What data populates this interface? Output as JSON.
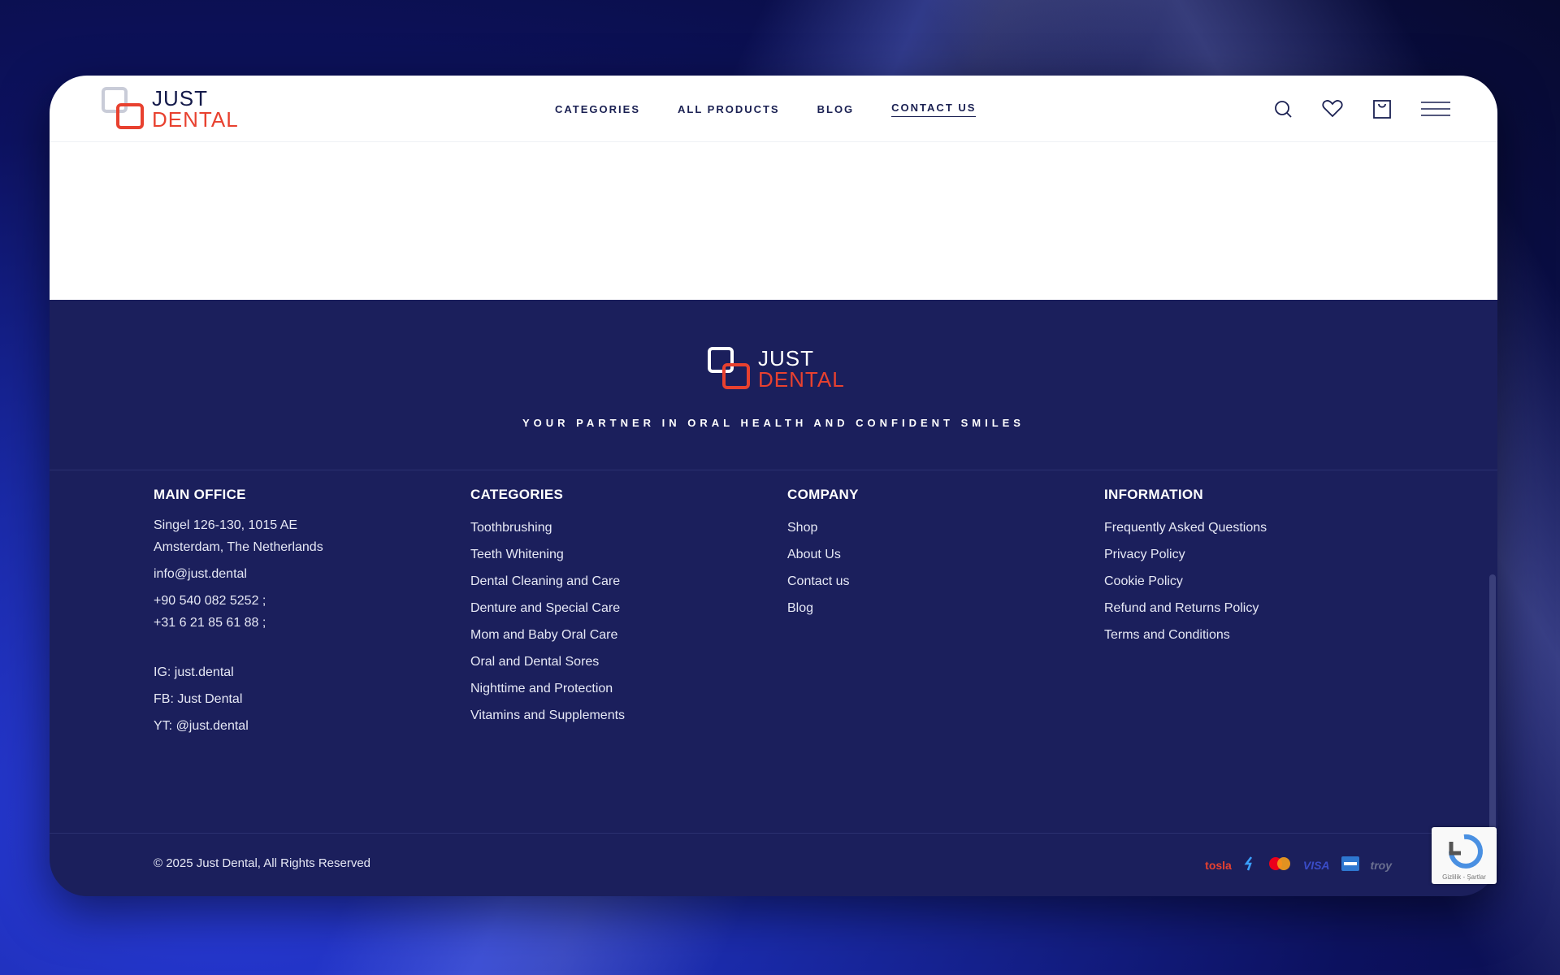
{
  "header": {
    "logo": {
      "line1": "JUST",
      "line2": "DENTAL"
    },
    "nav": [
      {
        "label": "CATEGORIES"
      },
      {
        "label": "ALL PRODUCTS"
      },
      {
        "label": "BLOG"
      },
      {
        "label": "CONTACT US",
        "active": true
      }
    ],
    "icons": [
      "search-icon",
      "heart-icon",
      "bag-icon",
      "menu-icon"
    ]
  },
  "footer": {
    "logo": {
      "line1": "JUST",
      "line2": "DENTAL"
    },
    "tagline": "YOUR PARTNER IN ORAL HEALTH AND CONFIDENT SMILES",
    "main_office": {
      "title": "MAIN OFFICE",
      "address1": "Singel 126-130, 1015 AE",
      "address2": "Amsterdam, The Netherlands",
      "email": "info@just.dental",
      "phone1": "+90 540 082 5252 ;",
      "phone2": "+31 6 21 85 61 88 ;",
      "ig": "IG: just.dental",
      "fb": "FB: Just Dental",
      "yt": "YT: @just.dental"
    },
    "categories": {
      "title": "CATEGORIES",
      "items": [
        "Toothbrushing",
        "Teeth Whitening",
        "Dental Cleaning and Care",
        "Denture and Special Care",
        "Mom and Baby Oral Care",
        "Oral and Dental Sores",
        "Nighttime and Protection",
        "Vitamins and Supplements"
      ]
    },
    "company": {
      "title": "COMPANY",
      "items": [
        "Shop",
        "About Us",
        "Contact us",
        "Blog"
      ]
    },
    "information": {
      "title": "INFORMATION",
      "items": [
        "Frequently Asked Questions",
        "Privacy Policy",
        "Cookie Policy",
        "Refund and Returns Policy",
        "Terms and Conditions"
      ]
    },
    "copyright": "© 2025 Just Dental, All Rights Reserved",
    "payments": [
      {
        "label": "tosla",
        "color": "#e8412f"
      },
      {
        "label": "mastercard",
        "color": "#ff5f00"
      },
      {
        "label": "VISA",
        "color": "#3a4cc8"
      },
      {
        "label": "troy",
        "color": "#6b7090"
      }
    ]
  },
  "recaptcha": {
    "label": "Gizlilik - Şartlar"
  },
  "colors": {
    "navy": "#1b1f5c",
    "accent": "#e8412f",
    "white": "#ffffff"
  }
}
